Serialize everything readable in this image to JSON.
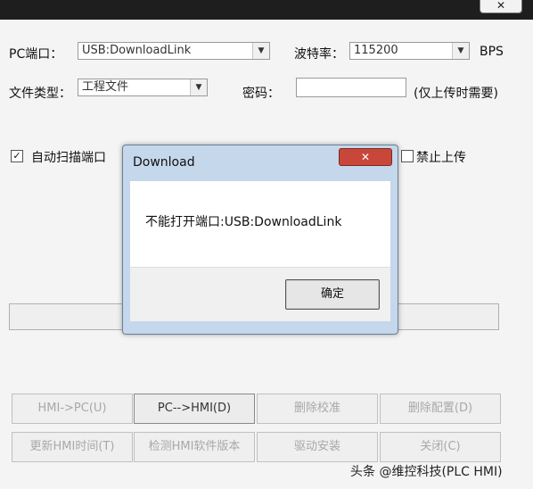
{
  "window": {
    "close_glyph": "✕"
  },
  "form": {
    "pc_port_label": "PC端口：",
    "pc_port_value": "USB:DownloadLink",
    "baud_label": "波特率：",
    "baud_value": "115200",
    "baud_unit": "BPS",
    "file_type_label": "文件类型：",
    "file_type_value": "工程文件",
    "password_label": "密码：",
    "password_value": "",
    "password_note": "(仅上传时需要)",
    "auto_scan_label": "自动扫描端口",
    "auto_scan_checked": true,
    "forbid_upload_label": "禁止上传",
    "forbid_upload_checked": false
  },
  "buttons": {
    "hmi_to_pc": "HMI->PC(U)",
    "pc_to_hmi": "PC-->HMI(D)",
    "delete_calibration": "删除校准",
    "delete_config": "删除配置(D)",
    "update_hmi_time": "更新HMI时间(T)",
    "check_hmi_version": "检测HMI软件版本",
    "driver_install": "驱动安装",
    "close": "关闭(C)"
  },
  "dialog": {
    "title": "Download",
    "close_glyph": "✕",
    "message": "不能打开端口:USB:DownloadLink",
    "ok_label": "确定"
  },
  "watermark": "头条 @维控科技(PLC HMI)",
  "icons": {
    "dropdown": "chevron-down-icon",
    "check": "checkmark-icon",
    "close": "close-icon"
  }
}
